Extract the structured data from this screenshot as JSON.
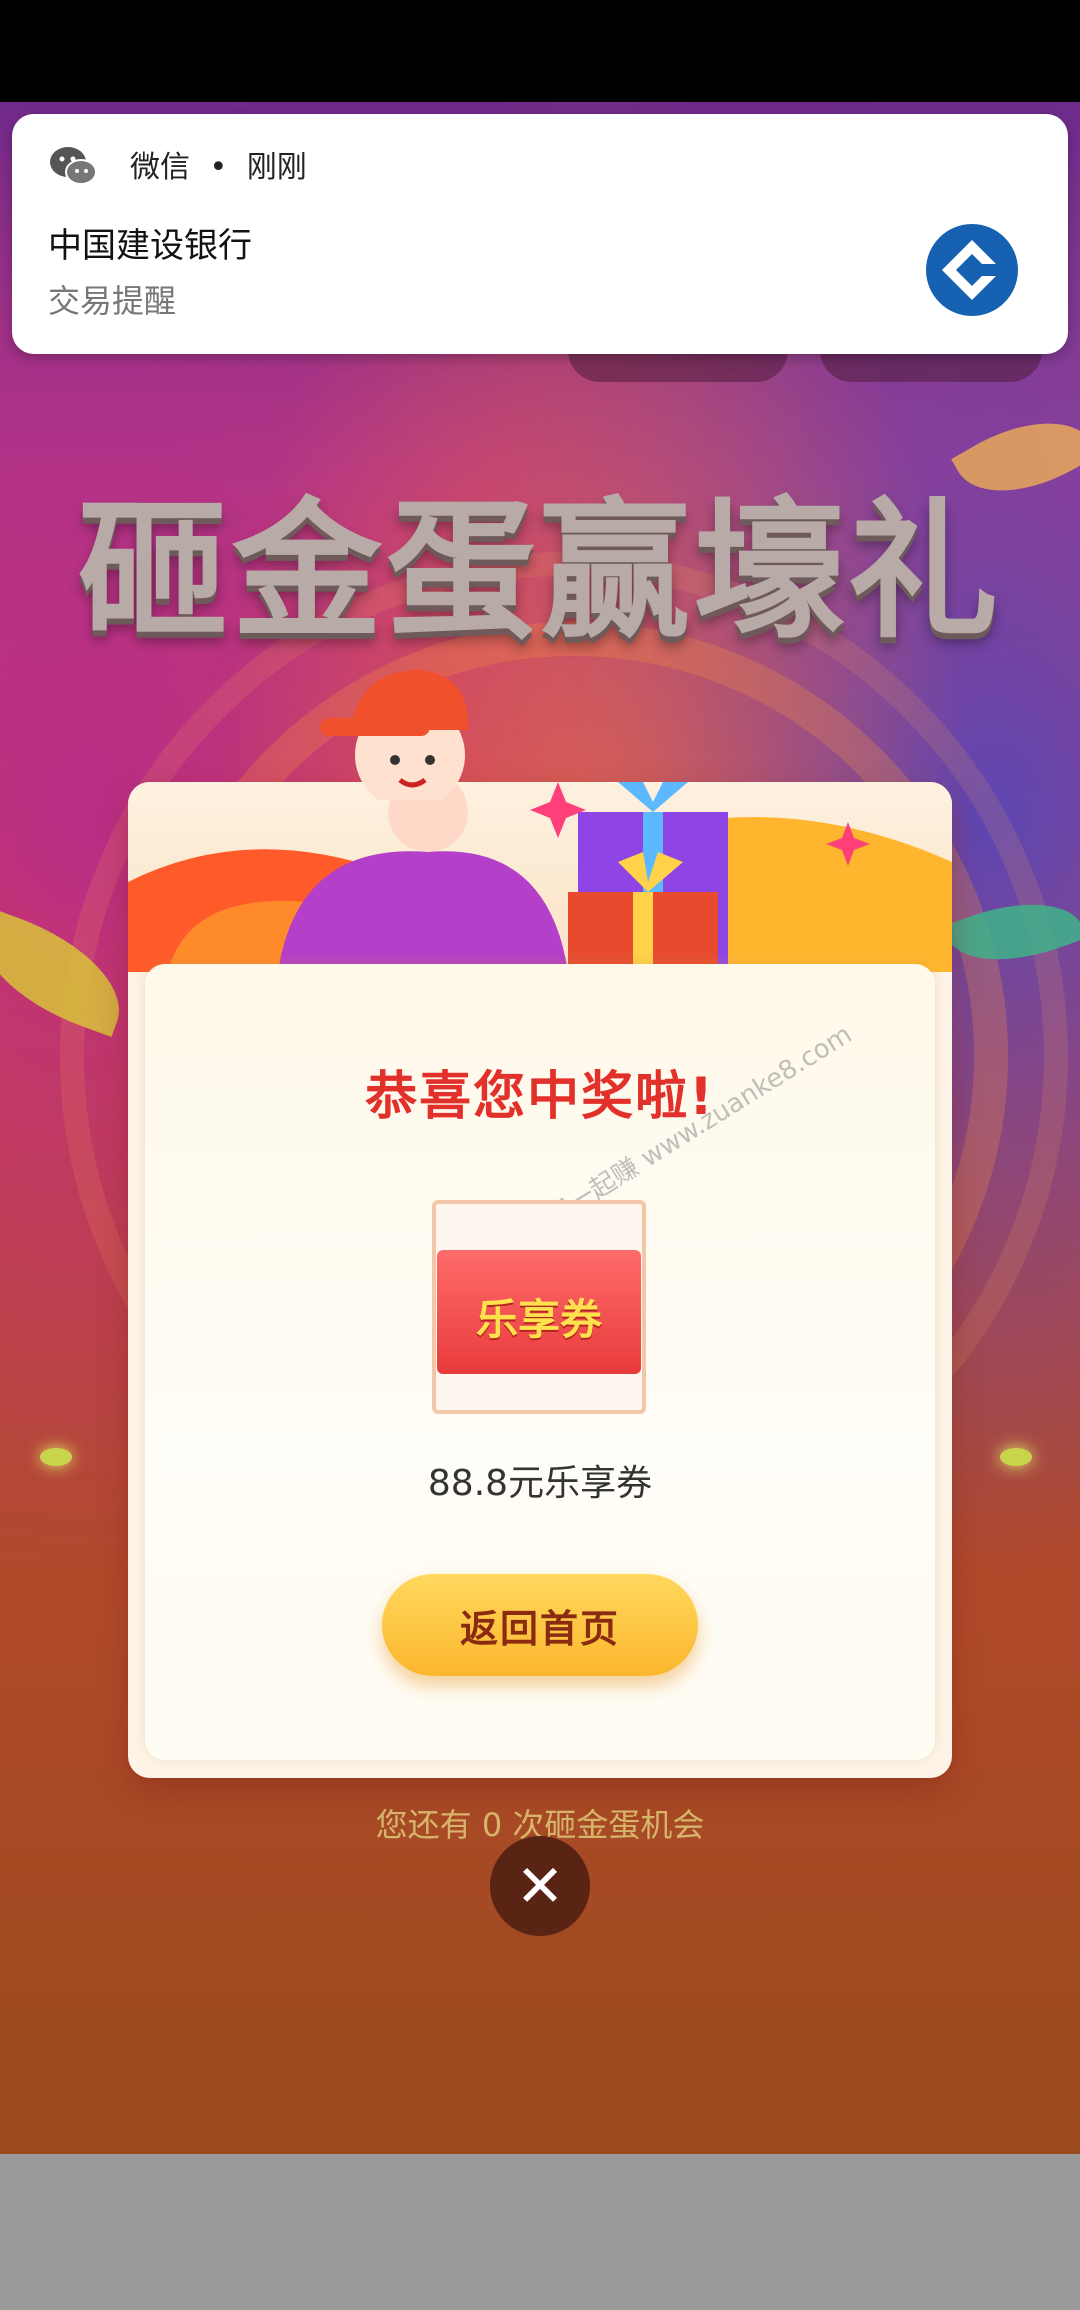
{
  "notification": {
    "app": "微信",
    "time": "刚刚",
    "separator": "•",
    "title": "中国建设银行",
    "body": "交易提醒",
    "icon": "wechat-icon",
    "logo": "ccb-logo-icon"
  },
  "page": {
    "hero_title": "砸金蛋赢壕礼"
  },
  "dialog": {
    "headline": "恭喜您中奖啦!",
    "coupon_label": "乐享券",
    "prize": "88.8元乐享券",
    "home_button": "返回首页",
    "close_icon": "close-icon"
  },
  "footer": {
    "chances_text": "您还有 0 次砸金蛋机会"
  },
  "watermark": "赚客吧，有奖一起赚 www.zuanke8.com",
  "colors": {
    "headline": "#e2302a",
    "button": "#fbb62c",
    "bank_blue": "#1761b3"
  }
}
